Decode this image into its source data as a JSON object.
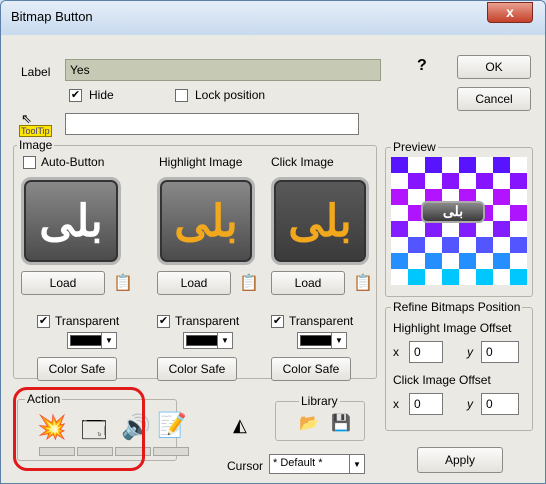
{
  "window": {
    "title": "Bitmap Button",
    "close_glyph": "x"
  },
  "label_row": {
    "label": "Label",
    "value": "Yes"
  },
  "hide": {
    "label": "Hide",
    "checked": true
  },
  "lock": {
    "label": "Lock position",
    "checked": false
  },
  "tooltip": {
    "tag": "ToolTip",
    "value": ""
  },
  "buttons": {
    "ok": "OK",
    "cancel": "Cancel",
    "help_glyph": "?",
    "apply": "Apply",
    "load": "Load",
    "color_safe": "Color Safe"
  },
  "image_group": {
    "title": "Image",
    "auto_button": {
      "label": "Auto-Button",
      "checked": false
    },
    "highlight_label": "Highlight Image",
    "click_label": "Click Image",
    "bitmap_text": "بلی",
    "transparent_label": "Transparent",
    "transparent_checked": true
  },
  "preview": {
    "title": "Preview",
    "button_text": "بلی"
  },
  "refine": {
    "title": "Refine Bitmaps Position",
    "highlight_offset": "Highlight Image Offset",
    "click_offset": "Click Image Offset",
    "x_label": "x",
    "y_label": "y",
    "hx": "0",
    "hy": "0",
    "cx": "0",
    "cy": "0"
  },
  "action": {
    "title": "Action"
  },
  "library": {
    "title": "Library"
  },
  "cursor": {
    "label": "Cursor",
    "value": "* Default *"
  },
  "colors": {
    "highlight_text": "#f2a81d",
    "annotation": "#e11919"
  }
}
